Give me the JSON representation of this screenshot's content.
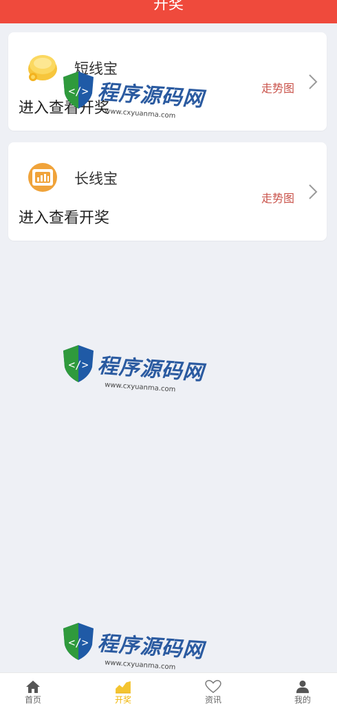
{
  "header": {
    "title": "开奖"
  },
  "cards": [
    {
      "name": "短线宝",
      "subtitle": "进入查看开奖",
      "trend_label": "走势图",
      "icon": "gold-coin-icon"
    },
    {
      "name": "长线宝",
      "subtitle": "进入查看开奖",
      "trend_label": "走势图",
      "icon": "bar-chart-box-icon"
    }
  ],
  "watermark": {
    "brand": "程序源码网",
    "url": "www.cxyuanma.com"
  },
  "tabbar": {
    "items": [
      {
        "label": "首页",
        "icon": "home-icon"
      },
      {
        "label": "开奖",
        "icon": "trend-chart-icon",
        "active": true
      },
      {
        "label": "资讯",
        "icon": "heart-icon"
      },
      {
        "label": "我的",
        "icon": "user-icon"
      }
    ]
  },
  "colors": {
    "header_bg": "#ef4a3c",
    "page_bg": "#eef0f5",
    "trend_text": "#c9524a",
    "active_tab": "#f0b400"
  }
}
